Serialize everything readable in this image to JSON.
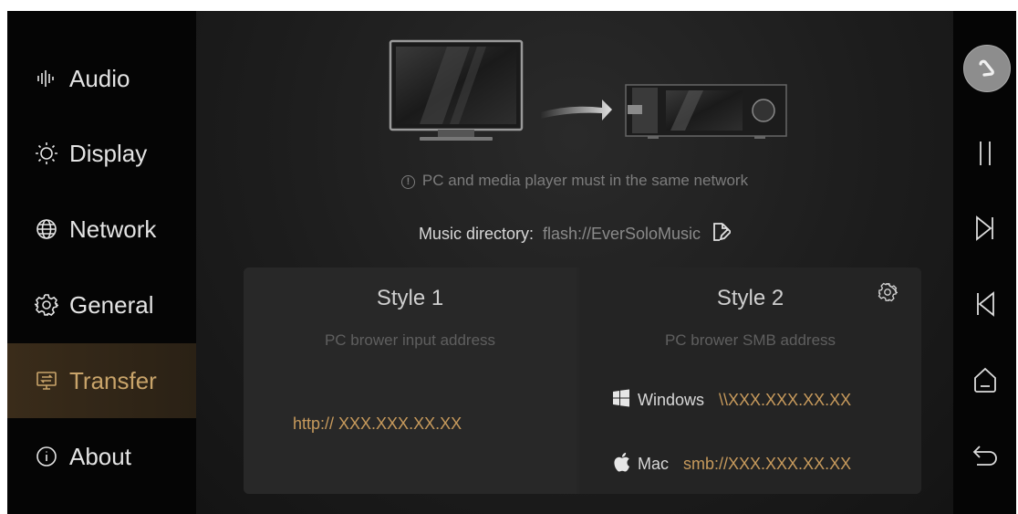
{
  "sidebar": {
    "items": [
      {
        "label": "Audio",
        "icon": "audio-waveform-icon",
        "active": false
      },
      {
        "label": "Display",
        "icon": "brightness-icon",
        "active": false
      },
      {
        "label": "Network",
        "icon": "globe-icon",
        "active": false
      },
      {
        "label": "General",
        "icon": "gear-icon",
        "active": false
      },
      {
        "label": "Transfer",
        "icon": "transfer-icon",
        "active": true
      },
      {
        "label": "About",
        "icon": "info-icon",
        "active": false
      }
    ]
  },
  "main": {
    "illustration": {
      "icon": "pc-to-player-illustration"
    },
    "network_note": "PC and media player must in the same network",
    "music_directory": {
      "label": "Music directory:",
      "value": "flash://EverSoloMusic",
      "edit_icon": "edit-folder-icon"
    },
    "style1": {
      "title": "Style 1",
      "subtitle": "PC brower input address",
      "address": "http:// XXX.XXX.XX.XX"
    },
    "style2": {
      "title": "Style 2",
      "subtitle": "PC brower SMB address",
      "settings_icon": "gear-icon",
      "windows": {
        "label": "Windows",
        "address": "\\\\XXX.XXX.XX.XX",
        "icon": "windows-logo-icon"
      },
      "mac": {
        "label": "Mac",
        "address": "smb://XXX.XXX.XX.XX",
        "icon": "apple-logo-icon"
      }
    }
  },
  "controls": {
    "items": [
      "avatar",
      "pause-icon",
      "next-track-icon",
      "previous-track-icon",
      "home-icon",
      "back-icon"
    ]
  },
  "colors": {
    "accent": "#c79a5c",
    "active_nav_bg": "#3a2c1a",
    "panel_bg": "#262626",
    "background": "#1d1d1d"
  }
}
